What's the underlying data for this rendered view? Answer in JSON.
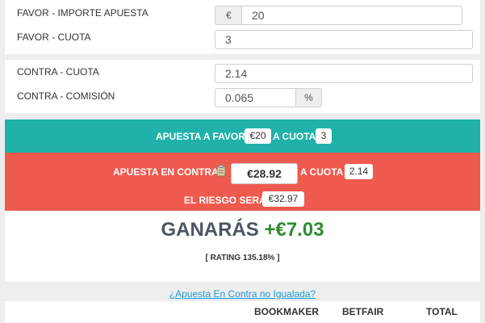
{
  "back": {
    "stake_label": "FAVOR - IMPORTE APUESTA",
    "currency_addon": "€",
    "stake_value": "20",
    "odds_label": "FAVOR - CUOTA",
    "odds_value": "3"
  },
  "lay": {
    "odds_label": "CONTRA - CUOTA",
    "odds_value": "2.14",
    "commission_label": "CONTRA - COMISIÓN",
    "commission_value": "0.065",
    "percent_addon": "%"
  },
  "result": {
    "back_prefix": "APUESTA A FAVOR",
    "back_stake": "€20",
    "back_odds_prefix": "A CUOTA",
    "back_odds": "3",
    "lay_prefix": "APUESTA EN CONTRA",
    "lay_stake": "€28.92",
    "lay_odds_prefix": "A CUOTA",
    "lay_odds": "2.14",
    "risk_prefix": "EL RIESGO SERÁ",
    "risk_value": "€32.97",
    "win_label": "GANARÁS",
    "win_value": "+€7.03",
    "rating": "[ RATING 135.18% ]"
  },
  "links": {
    "underlay": "¿Apuesta En Contra no Igualada?"
  },
  "table": {
    "headers": [
      "BOOKMAKER",
      "BETFAIR",
      "TOTAL"
    ]
  },
  "colors": {
    "teal": "#20b2aa",
    "red": "#ef5a4f",
    "green": "#2e8b2e",
    "link": "#1a9ad6"
  }
}
